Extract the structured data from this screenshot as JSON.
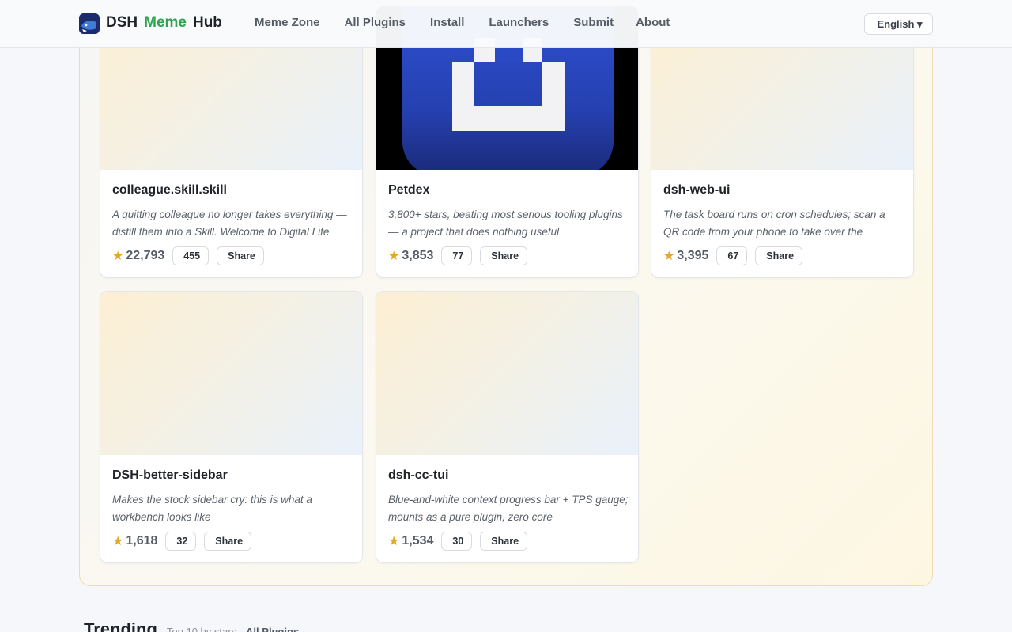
{
  "header": {
    "brand": {
      "part1": "DSH",
      "part2": "Meme",
      "part3": "Hub"
    },
    "nav": [
      {
        "icon": "",
        "label": "Meme Zone"
      },
      {
        "icon": "",
        "label": "All Plugins"
      },
      {
        "icon": "",
        "label": "Install"
      },
      {
        "icon": "",
        "label": "Launchers"
      },
      {
        "icon": "",
        "label": "Submit"
      },
      {
        "label": "About"
      }
    ],
    "language": {
      "icon": "",
      "label": "English ▾"
    }
  },
  "cards": [
    {
      "title": "colleague.skill.skill",
      "lead": "",
      "desc": "A quitting colleague no longer takes everything — distill them into a Skill. Welcome to Digital Life",
      "stars": "22,793",
      "forks": "455",
      "share": "Share",
      "thumb_icon": ""
    },
    {
      "title": "Petdex",
      "lead": "",
      "desc": "3,800+ stars, beating most serious tooling plugins — a project that does nothing useful",
      "stars": "3,853",
      "forks": "77",
      "share": "Share",
      "thumb_icon": "petdex-logo"
    },
    {
      "title": "dsh-web-ui",
      "lead": "",
      "desc": "The task board runs on cron schedules; scan a QR code from your phone to take over the",
      "stars": "3,395",
      "forks": "67",
      "share": "Share",
      "thumb_icon": ""
    },
    {
      "title": "DSH-better-sidebar",
      "lead": "",
      "desc": "Makes the stock sidebar cry: this is what a workbench looks like",
      "stars": "1,618",
      "forks": "32",
      "share": "Share",
      "thumb_icon": ""
    },
    {
      "title": "dsh-cc-tui",
      "lead": "",
      "desc": "Blue-and-white context progress bar + TPS gauge; mounts as a pure plugin, zero core",
      "stars": "1,534",
      "forks": "30",
      "share": "Share",
      "thumb_icon": ""
    }
  ],
  "icons": {
    "star": "★",
    "fork": "",
    "share": ""
  },
  "trending": {
    "icon": "",
    "title": "Trending",
    "subtitle": "Top 10 by stars",
    "link_icon": "",
    "link": "All Plugins"
  },
  "colors": {
    "accent": "#2da44e",
    "star": "#e3a826",
    "thumb_icon": "#2a8a39"
  }
}
